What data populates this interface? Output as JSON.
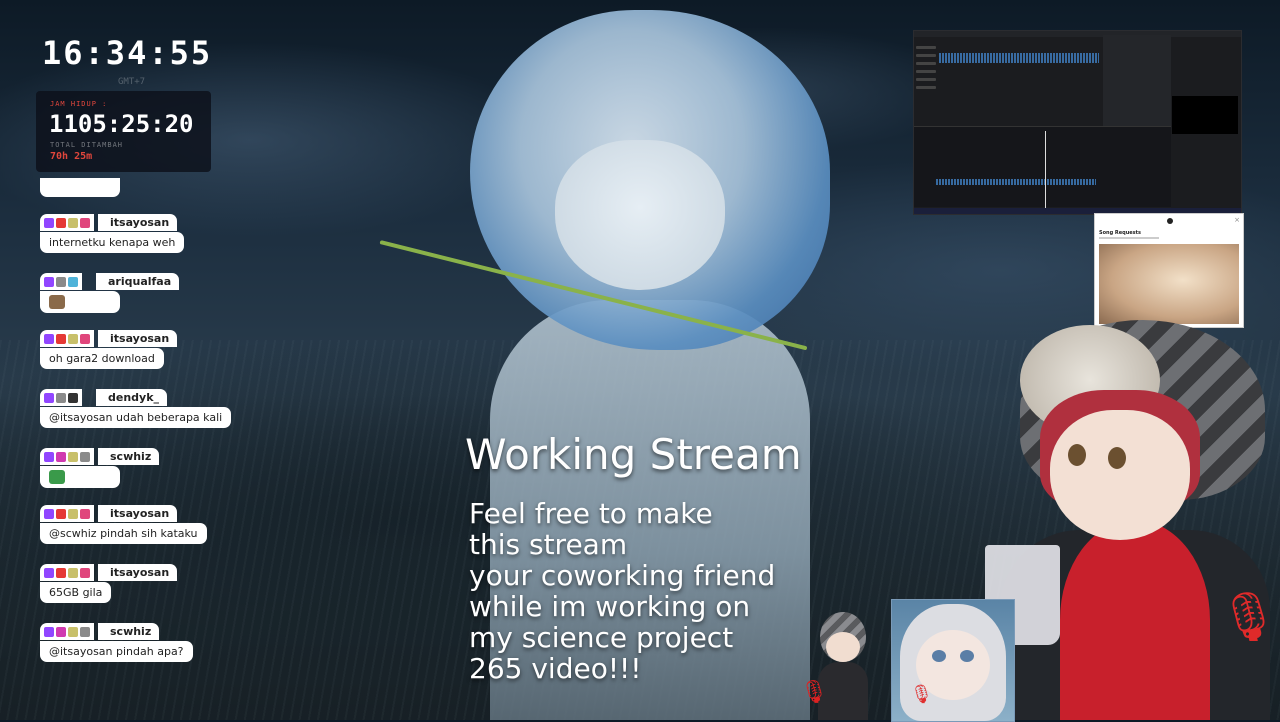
{
  "clock": {
    "time": "16:34:55",
    "timezone": "GMT+7"
  },
  "uptime": {
    "label": "JAM HIDUP :",
    "value": "1105:25:20",
    "added_label": "TOTAL DITAMBAH",
    "added_value": "70h 25m"
  },
  "chat": [
    {
      "user": "itsayosan",
      "text": "internetku kenapa weh",
      "badges": [
        "b-twitch",
        "b-red",
        "b-star",
        "b-heart"
      ]
    },
    {
      "user": "ariqualfaa",
      "text": "",
      "emote": true,
      "badges": [
        "b-twitch",
        "b-gray",
        "b-drop"
      ]
    },
    {
      "user": "itsayosan",
      "text": "oh gara2 download",
      "badges": [
        "b-twitch",
        "b-red",
        "b-star",
        "b-heart"
      ]
    },
    {
      "user": "dendyk_",
      "text": "@itsayosan udah beberapa kali",
      "badges": [
        "b-twitch",
        "b-gray",
        "b-dark"
      ]
    },
    {
      "user": "scwhiz",
      "text": "",
      "emote": true,
      "badges": [
        "b-twitch",
        "b-pink",
        "b-star",
        "b-gray"
      ]
    },
    {
      "user": "itsayosan",
      "text": "@scwhiz pindah sih kataku",
      "badges": [
        "b-twitch",
        "b-red",
        "b-star",
        "b-heart"
      ]
    },
    {
      "user": "itsayosan",
      "text": "65GB gila",
      "badges": [
        "b-twitch",
        "b-red",
        "b-star",
        "b-heart"
      ]
    },
    {
      "user": "scwhiz",
      "text": "@itsayosan pindah apa?",
      "badges": [
        "b-twitch",
        "b-pink",
        "b-star",
        "b-gray"
      ]
    }
  ],
  "overlay": {
    "title": "Working Stream",
    "description": "Feel free to make\nthis stream\nyour coworking friend\nwhile im working on\nmy science project\n265 video!!!"
  },
  "song_requests": {
    "title": "Song Requests"
  },
  "colors": {
    "accent_red": "#e0463c",
    "twitch_purple": "#9146ff"
  }
}
